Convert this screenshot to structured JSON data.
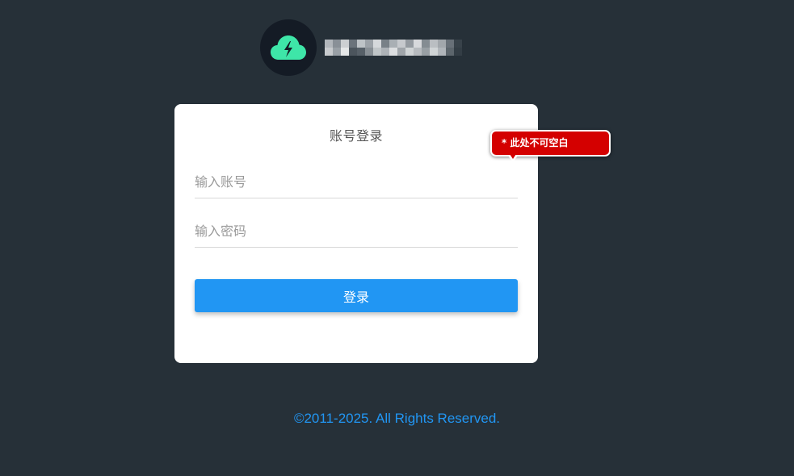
{
  "brand": {
    "logo_icon": "cloud-lightning-icon",
    "logo_bg_color": "#141b25",
    "logo_accent_color": "#3ee6a8"
  },
  "login": {
    "title": "账号登录",
    "account_placeholder": "输入账号",
    "password_placeholder": "输入密码",
    "submit_label": "登录",
    "button_color": "#2196f3"
  },
  "validation": {
    "message": "* 此处不可空白",
    "color": "#d40000"
  },
  "footer": {
    "copyright": "©2011-2025. All Rights Reserved."
  },
  "colors": {
    "background": "#263038",
    "card": "#ffffff"
  }
}
